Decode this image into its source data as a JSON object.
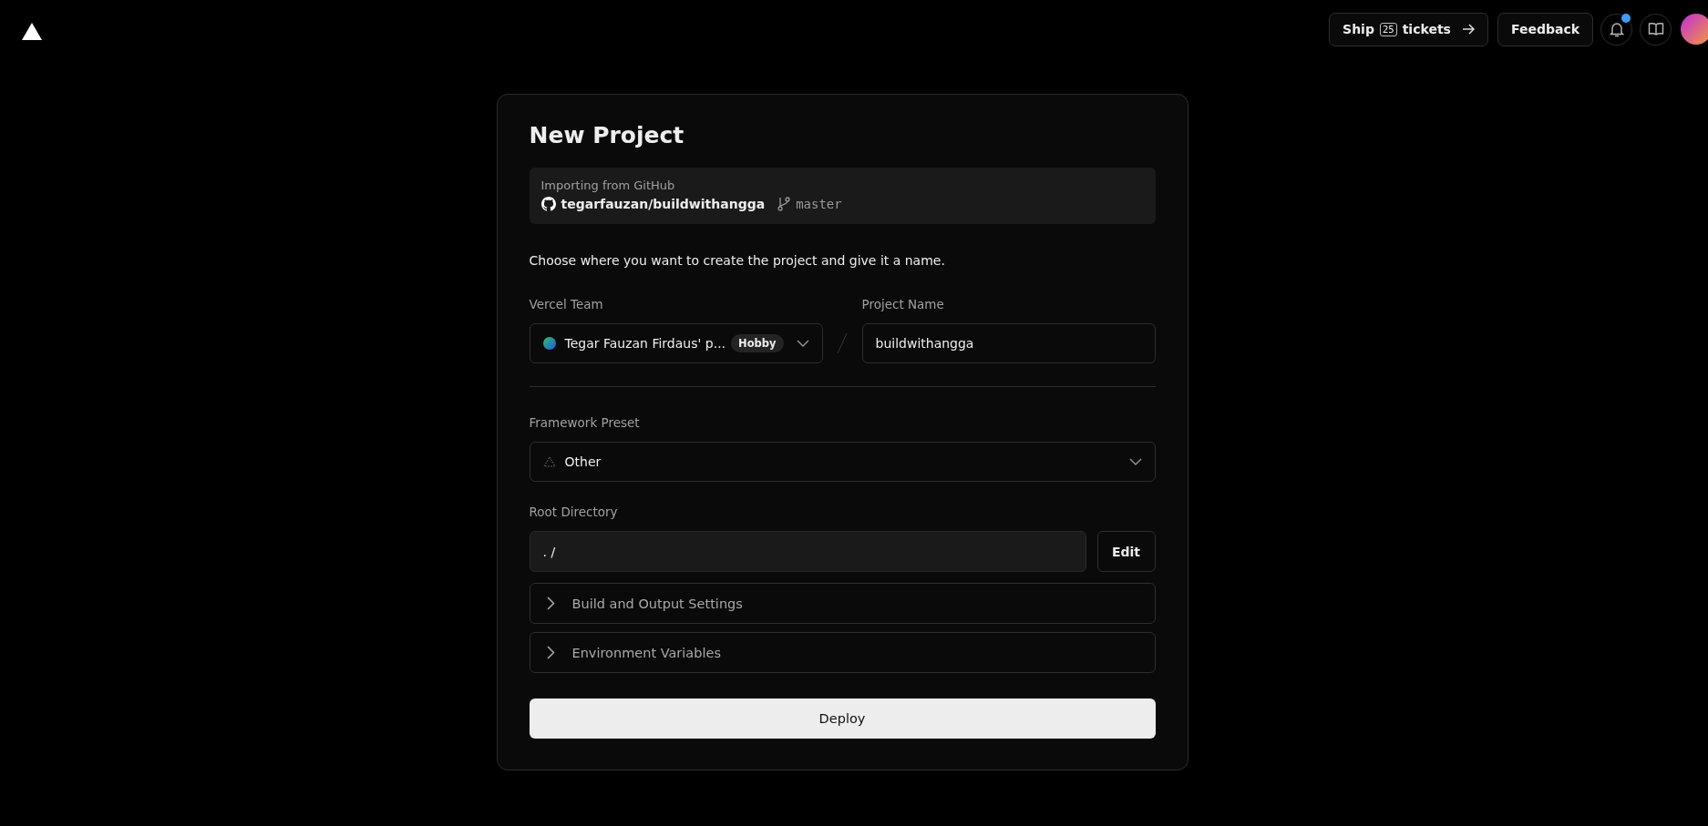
{
  "header": {
    "ship_button": {
      "prefix": "Ship",
      "count": "25",
      "suffix": "tickets"
    },
    "feedback_button": "Feedback",
    "notifications": {
      "unread": true
    }
  },
  "card": {
    "title": "New Project",
    "import": {
      "label": "Importing from GitHub",
      "repo": "tegarfauzan/buildwithangga",
      "branch": "master"
    },
    "intro": "Choose where you want to create the project and give it a name.",
    "team": {
      "label": "Vercel Team",
      "value": "Tegar Fauzan Firdaus' p...",
      "badge": "Hobby"
    },
    "project_name": {
      "label": "Project Name",
      "value": "buildwithangga"
    },
    "framework": {
      "label": "Framework Preset",
      "value": "Other"
    },
    "root": {
      "label": "Root Directory",
      "value": ". /",
      "button": "Edit"
    },
    "sections": [
      {
        "label": "Build and Output Settings",
        "expanded": false
      },
      {
        "label": "Environment Variables",
        "expanded": false
      }
    ],
    "deploy": "Deploy"
  }
}
